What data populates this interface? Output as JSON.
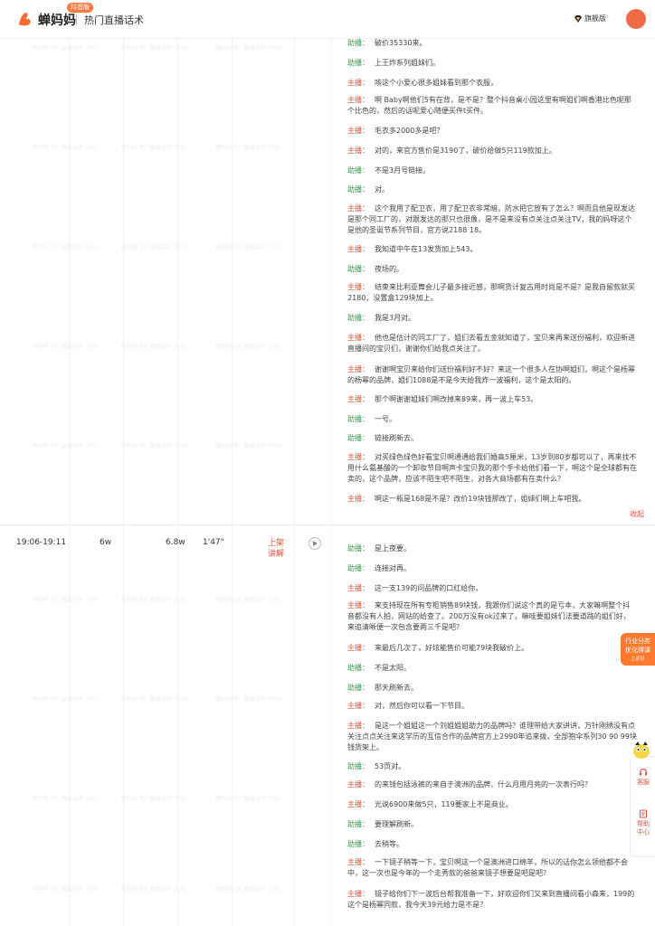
{
  "header": {
    "brand": "蝉妈妈",
    "brand_badge": "抖音版",
    "page_title": "热门直播话术",
    "version_label": "旗舰版",
    "version_caret": "›",
    "accent_color": "#ff6a2f"
  },
  "session_row": {
    "time_range": "19:06-19:11",
    "viewers": "6w",
    "sales": "6.8w",
    "duration": "1'47\"",
    "product_link_label": "上架讲解"
  },
  "collapse_label": "收起",
  "watermark_text": "蝉妈妈 热门直播话术 3591",
  "float_card": {
    "line1": "行业分类",
    "line2": "优化得课",
    "line3": "立即领"
  },
  "float_panel": {
    "feedback": "客服",
    "help_line1": "帮助",
    "help_line2": "中心"
  },
  "transcript_top": [
    {
      "speaker": "助播",
      "role": "asst",
      "text": "破价35330来。"
    },
    {
      "speaker": "助播",
      "role": "asst",
      "text": "上王炸系列姐妹们。"
    },
    {
      "speaker": "主播",
      "role": "host",
      "text": "咳这个小爱心很多姐妹看到那个衣服，"
    },
    {
      "speaker": "主播",
      "role": "host",
      "text": "啊 Baby啊他们5有在背，是不是？整个抖音桌小园这里有啊姐们啊香港比色呢那个比色的，然后的话呢爱心随便买件t买件。"
    },
    {
      "speaker": "主播",
      "role": "host",
      "text": "毛衣多2000多是吧？"
    },
    {
      "speaker": "主播",
      "role": "host",
      "text": "对的，来官方售价是3190了，破价给做5只119款加上。"
    },
    {
      "speaker": "助播",
      "role": "asst",
      "text": "不是3月号链接。"
    },
    {
      "speaker": "助播",
      "role": "asst",
      "text": "对。"
    },
    {
      "speaker": "主播",
      "role": "host",
      "text": "这个我用了配卫衣，用了配卫衣非常暗，防水把它放有了怎么？啊而且他是现发达是那个同工厂的，对跟发达的那只也很像，是不是来没有点关注点关注TV，我的妈呀这个是他的圣诞节系列节目，官方说2188 18。"
    },
    {
      "speaker": "主播",
      "role": "host",
      "text": "我知道中午在13发货加上543。"
    },
    {
      "speaker": "助播",
      "role": "asst",
      "text": "夜场的。"
    },
    {
      "speaker": "主播",
      "role": "host",
      "text": "结束来比利亚舞会儿子最多接近感，那啊货计复古用时尚是不是？是我自留款就买2180，没置盒129块加上。"
    },
    {
      "speaker": "助播",
      "role": "asst",
      "text": "我是3月对。"
    },
    {
      "speaker": "主播",
      "role": "host",
      "text": "他也是估计的同工厂了，姐们去看五金就知道了，宝贝来再来送份福利，欢迎新进直播间的宝贝们，谢谢你们给我点关注了。"
    },
    {
      "speaker": "主播",
      "role": "host",
      "text": "谢谢啊宝贝来给你们送份福利好不好？来这一个很多人在协啊姐们，啊这个是杨幂的杨幂的品牌，姐们1088是不是今天给我炸一波福利，这个是太阳的。"
    },
    {
      "speaker": "主播",
      "role": "host",
      "text": "那个啊谢谢姐妹们啊改掉来89来，再一波上车53。"
    },
    {
      "speaker": "助播",
      "role": "asst",
      "text": "一号。"
    },
    {
      "speaker": "助播",
      "role": "asst",
      "text": "链接刷新去。"
    },
    {
      "speaker": "主播",
      "role": "host",
      "text": "对买绿色绿色好看宝贝啊通通给我们婚高5厘米，13岁到80岁都可以了，再来找不用什么氨基酸的一个卸妆节目啊声卡宝贝我的那个手卡给他们看一下，啊这个是全球都有在卖的，这个品牌，应该不陌生吧不陌生，对各大商场都有在卖什么？"
    },
    {
      "speaker": "主播",
      "role": "host",
      "text": "啊这一瓶是168是不是？改价19块钱那改了，姐妹们啊上车吧我。"
    }
  ],
  "transcript_bottom": [
    {
      "speaker": "助播",
      "role": "asst",
      "text": "是上夜要。"
    },
    {
      "speaker": "助播",
      "role": "asst",
      "text": "连接对再。"
    },
    {
      "speaker": "主播",
      "role": "host",
      "text": "这一支139的问品牌的口红给你，"
    },
    {
      "speaker": "主播",
      "role": "host",
      "text": "来支持现在所有专柜销售89块钱，我跟你们说这个真的是亏本，大家嘛啊整个抖音都没有人拍，网站的给查了。200万没有ok过来了。嘛哇要姐妹们法要道路的姐们好，来追清晰便一次包含要两三千是吧？"
    },
    {
      "speaker": "主播",
      "role": "host",
      "text": "来最后几次了，好炫能售价可能79块我破价上。"
    },
    {
      "speaker": "助播",
      "role": "asst",
      "text": "不是太阳。"
    },
    {
      "speaker": "助播",
      "role": "asst",
      "text": "那天刷新去。"
    },
    {
      "speaker": "主播",
      "role": "host",
      "text": "对，然后你可以看一下节目。"
    },
    {
      "speaker": "主播",
      "role": "host",
      "text": "是这一个姐姐这一个刘姐姐姐助力的品牌吗？谁理带给大家讲讲，万针刚绣没有点关注点点关注来这学历的互信合作的品牌官方上2990年追来拨，全部抱伞系列30 90 99块钱货架上。"
    },
    {
      "speaker": "助播",
      "role": "asst",
      "text": "53页对。"
    },
    {
      "speaker": "主播",
      "role": "host",
      "text": "的来钱包括泳裤的来自于澳洲的品牌，什么月用月亮的一次表行吗？"
    },
    {
      "speaker": "主播",
      "role": "host",
      "text": "光说6900来做5只，119要家上不是商业。"
    },
    {
      "speaker": "助播",
      "role": "asst",
      "text": "要理解刷新。"
    },
    {
      "speaker": "助播",
      "role": "asst",
      "text": "去稍等。"
    },
    {
      "speaker": "主播",
      "role": "host",
      "text": "一下镜子稍等一下，宝贝啊这一个是澳洲进口绵羊，所以的话你怎么领他都不会中，这一次也是今年的一个走秀款的爸爸来镜子想要是吧是吧？"
    },
    {
      "speaker": "主播",
      "role": "host",
      "text": "镜子给你们下一波后台帮我准备一下，好欢迎你们又来到直播间看小森来，199的这个是杨幂同款，我今天39元给力是不是？"
    }
  ]
}
